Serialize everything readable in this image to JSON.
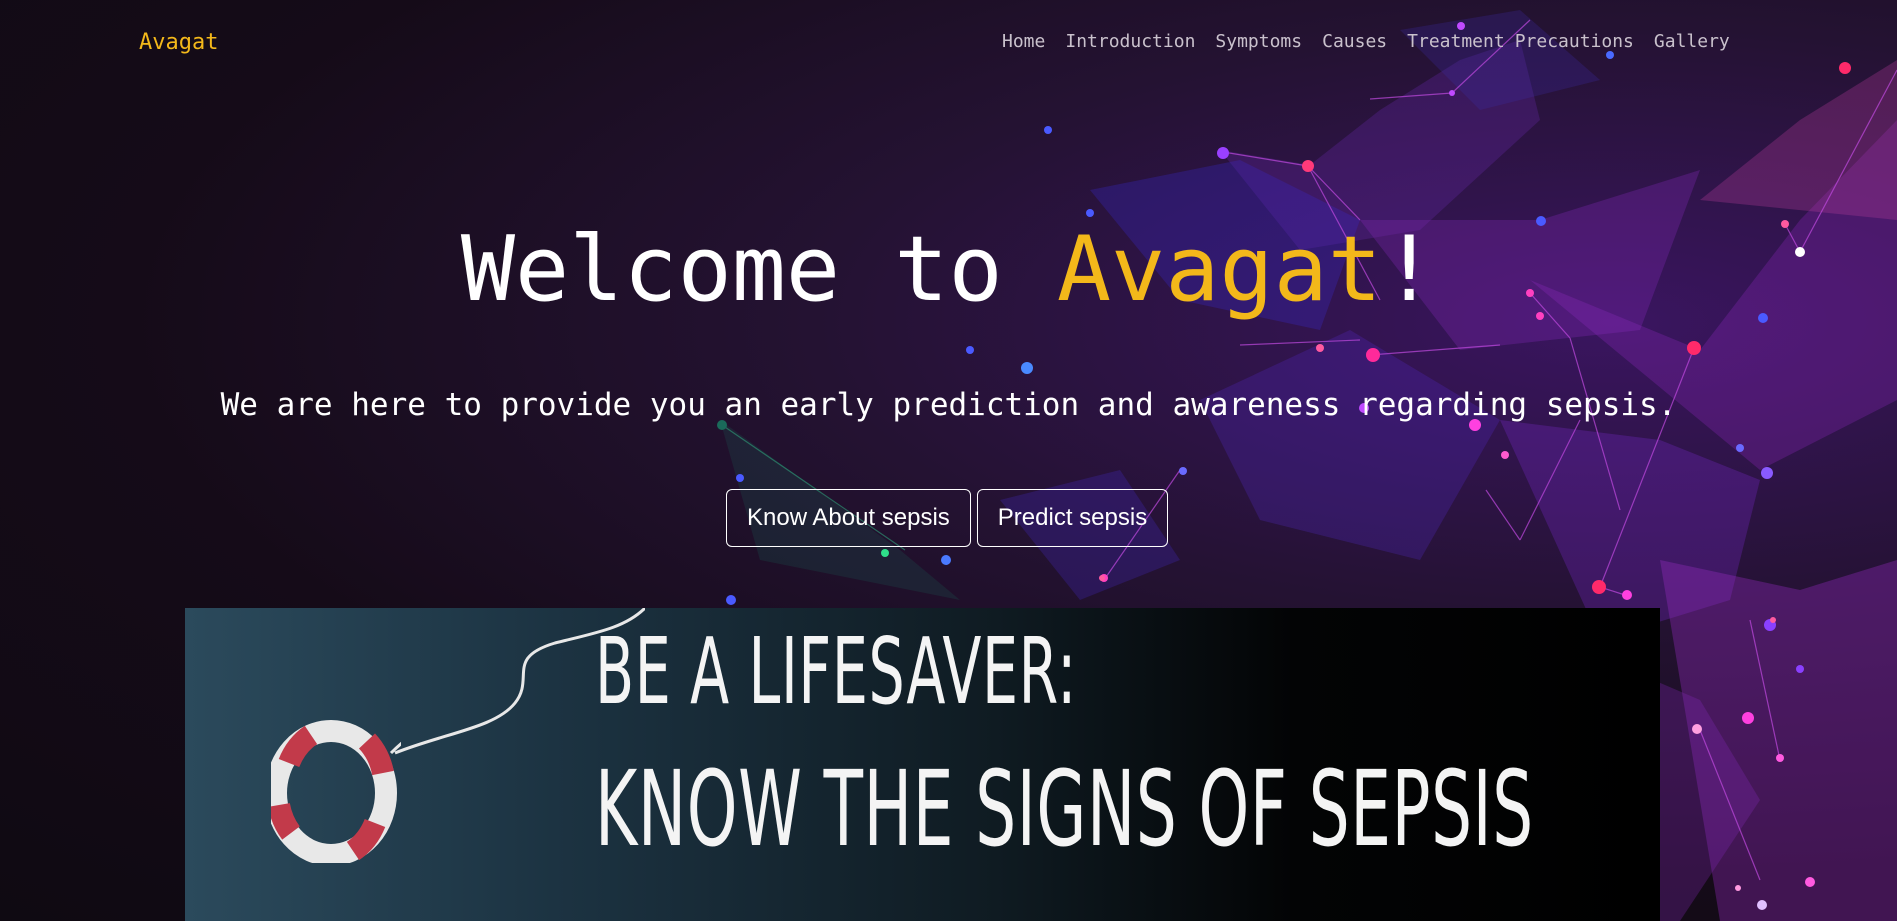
{
  "brand": "Avagat",
  "nav": {
    "home": "Home",
    "introduction": "Introduction",
    "symptoms": "Symptoms",
    "causes": "Causes",
    "treatment": "Treatment",
    "precautions": "Precautions",
    "gallery": "Gallery"
  },
  "hero": {
    "title_prefix": "Welcome to ",
    "title_accent": "Avagat",
    "title_suffix": "!",
    "subtitle": "We are here to provide you an early prediction and awareness regarding sepsis."
  },
  "buttons": {
    "know": "Know About sepsis",
    "predict": "Predict sepsis"
  },
  "banner": {
    "line1": "BE A LIFESAVER:",
    "line2": "KNOW THE SIGNS OF SEPSIS"
  },
  "colors": {
    "accent": "#f3b81a",
    "background": "#1a0f1c",
    "text": "#ffffff",
    "nav_text": "#c9c1cc"
  }
}
